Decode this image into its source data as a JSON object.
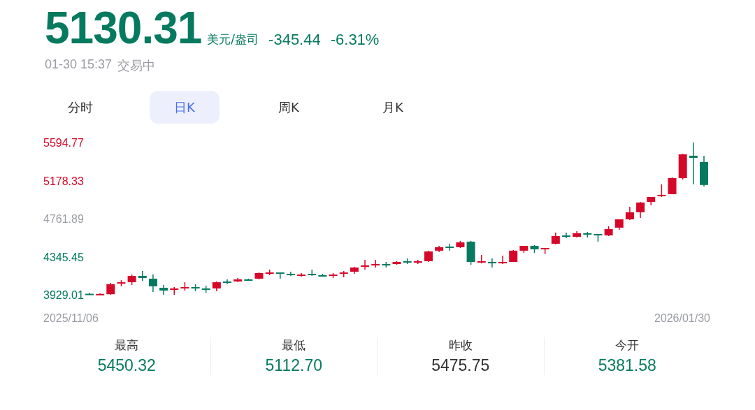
{
  "quote": {
    "price": "5130.31",
    "unit": "美元/盎司",
    "change": "-345.44",
    "change_percent": "-6.31%",
    "time": "01-30 15:37",
    "status": "交易中"
  },
  "tabs": [
    {
      "label": "分时",
      "selected": false
    },
    {
      "label": "日K",
      "selected": true
    },
    {
      "label": "周K",
      "selected": false
    },
    {
      "label": "月K",
      "selected": false
    }
  ],
  "chart": {
    "start_date": "2025/11/06",
    "end_date": "2026/01/30",
    "chart_data": {
      "type": "candlestick",
      "yticks": [
        {
          "value": 5594.77,
          "label": "5594.77"
        },
        {
          "value": 5178.33,
          "label": "5178.33"
        },
        {
          "value": 4761.89,
          "label": "4761.89"
        },
        {
          "value": 4345.45,
          "label": "4345.45"
        },
        {
          "value": 3929.01,
          "label": "3929.01"
        }
      ],
      "ylim": [
        3929.01,
        5594.77
      ],
      "categories": [
        null,
        null,
        null,
        null,
        null,
        null,
        null,
        null,
        null,
        null,
        null,
        null,
        null,
        null,
        null,
        null,
        null,
        null,
        null,
        null,
        null,
        null,
        null,
        null,
        null,
        null,
        null,
        null,
        null,
        null,
        null,
        null,
        null,
        null,
        null,
        null,
        null,
        null,
        null,
        null,
        null,
        null,
        null,
        null,
        null,
        null,
        null,
        null,
        null,
        null,
        null,
        null,
        null,
        null,
        null,
        null,
        null,
        null,
        null
      ],
      "ohlc": [
        [
          3940,
          3950,
          3929.01,
          3932
        ],
        [
          3932,
          3945,
          3929.01,
          3938
        ],
        [
          3935,
          4059,
          3929.01,
          4044
        ],
        [
          4051,
          4089,
          4021,
          4066
        ],
        [
          4066,
          4150,
          4036,
          4135
        ],
        [
          4135,
          4189,
          4082,
          4112
        ],
        [
          4105,
          4150,
          3959,
          4021
        ],
        [
          4005,
          4036,
          3929.01,
          3975
        ],
        [
          3982,
          4013,
          3929.01,
          3998
        ],
        [
          4005,
          4066,
          3975,
          4013
        ],
        [
          4013,
          4044,
          3967,
          4005
        ],
        [
          3998,
          4028,
          3952,
          3990
        ],
        [
          3998,
          4074,
          3967,
          4066
        ],
        [
          4074,
          4097,
          4044,
          4066
        ],
        [
          4074,
          4112,
          4066,
          4097
        ],
        [
          4097,
          4105,
          4082,
          4089
        ],
        [
          4105,
          4173,
          4097,
          4166
        ],
        [
          4166,
          4204,
          4143,
          4173
        ],
        [
          4173,
          4173,
          4105,
          4158
        ],
        [
          4158,
          4181,
          4135,
          4150
        ],
        [
          4143,
          4166,
          4128,
          4150
        ],
        [
          4158,
          4204,
          4135,
          4150
        ],
        [
          4143,
          4158,
          4128,
          4135
        ],
        [
          4135,
          4166,
          4112,
          4150
        ],
        [
          4158,
          4189,
          4120,
          4173
        ],
        [
          4181,
          4235,
          4158,
          4227
        ],
        [
          4235,
          4311,
          4204,
          4250
        ],
        [
          4257,
          4311,
          4227,
          4265
        ],
        [
          4265,
          4288,
          4227,
          4257
        ],
        [
          4265,
          4296,
          4257,
          4288
        ],
        [
          4296,
          4326,
          4265,
          4288
        ],
        [
          4280,
          4311,
          4265,
          4296
        ],
        [
          4296,
          4411,
          4288,
          4403
        ],
        [
          4411,
          4464,
          4395,
          4449
        ],
        [
          4456,
          4487,
          4411,
          4449
        ],
        [
          4449,
          4517,
          4441,
          4502
        ],
        [
          4510,
          4517,
          4257,
          4288
        ],
        [
          4288,
          4365,
          4273,
          4296
        ],
        [
          4288,
          4326,
          4227,
          4273
        ],
        [
          4280,
          4357,
          4265,
          4288
        ],
        [
          4288,
          4418,
          4288,
          4411
        ],
        [
          4411,
          4464,
          4388,
          4464
        ],
        [
          4464,
          4472,
          4388,
          4426
        ],
        [
          4426,
          4441,
          4372,
          4441
        ],
        [
          4487,
          4609,
          4479,
          4571
        ],
        [
          4578,
          4609,
          4548,
          4563
        ],
        [
          4563,
          4624,
          4556,
          4602
        ],
        [
          4602,
          4617,
          4556,
          4594
        ],
        [
          4594,
          4594,
          4510,
          4578
        ],
        [
          4578,
          4678,
          4571,
          4647
        ],
        [
          4663,
          4754,
          4640,
          4754
        ],
        [
          4754,
          4892,
          4747,
          4831
        ],
        [
          4831,
          4945,
          4770,
          4938
        ],
        [
          4945,
          4999,
          4907,
          4999
        ],
        [
          5014,
          5136,
          4999,
          5022
        ],
        [
          5029,
          5213,
          5029,
          5205
        ],
        [
          5205,
          5472,
          5190,
          5465
        ],
        [
          5450,
          5594.77,
          5136,
          5427
        ],
        [
          5381.58,
          5450.32,
          5112.7,
          5130.31
        ]
      ]
    }
  },
  "stats": [
    {
      "label": "最高",
      "value": "5450.32",
      "color": "#067a5f"
    },
    {
      "label": "最低",
      "value": "5112.70",
      "color": "#067a5f"
    },
    {
      "label": "昨收",
      "value": "5475.75",
      "color": "#333333"
    },
    {
      "label": "今开",
      "value": "5381.58",
      "color": "#067a5f"
    }
  ]
}
